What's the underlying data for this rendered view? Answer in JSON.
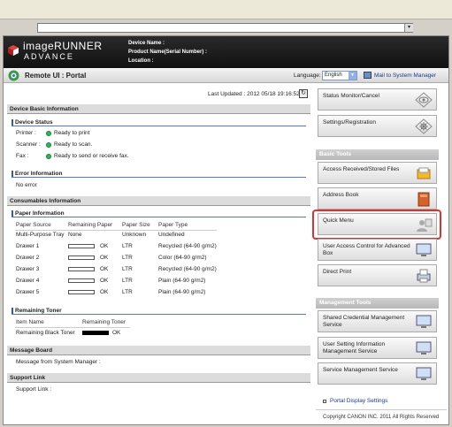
{
  "header": {
    "logo_line1": "imageRUNNER",
    "logo_line2": "ADVANCE",
    "device_name_label": "Device Name :",
    "product_name_label": "Product Name(Serial Number) :",
    "location_label": "Location :"
  },
  "nav": {
    "title": "Remote UI : Portal",
    "language_label": "Language:",
    "language_value": "English",
    "mail_link": "Mail to System Manager"
  },
  "main": {
    "last_updated": "Last Updated : 2012 05/18 19:16:52",
    "device_basic_info": "Device Basic Information",
    "device_status": "Device Status",
    "status_rows": [
      {
        "label": "Printer :",
        "value": "Ready to print"
      },
      {
        "label": "Scanner :",
        "value": "Ready to scan."
      },
      {
        "label": "Fax :",
        "value": "Ready to send or receive fax."
      }
    ],
    "error_info": "Error Information",
    "error_value": "No error",
    "consumables_info": "Consumables Information",
    "paper_info": "Paper Information",
    "paper_headers": [
      "Paper Source",
      "Remaining Paper",
      "Paper Size",
      "Paper Type"
    ],
    "paper_rows": [
      {
        "source": "Multi-Purpose Tray",
        "remaining": "None",
        "size": "Unknown",
        "type": "Undefined",
        "bar": false
      },
      {
        "source": "Drawer 1",
        "remaining": "OK",
        "size": "LTR",
        "type": "Recycled (64-90 g/m2)",
        "bar": true
      },
      {
        "source": "Drawer 2",
        "remaining": "OK",
        "size": "LTR",
        "type": "Color (64-90 g/m2)",
        "bar": true
      },
      {
        "source": "Drawer 3",
        "remaining": "OK",
        "size": "LTR",
        "type": "Recycled (64-90 g/m2)",
        "bar": true
      },
      {
        "source": "Drawer 4",
        "remaining": "OK",
        "size": "LTR",
        "type": "Plain (64-90 g/m2)",
        "bar": true
      },
      {
        "source": "Drawer 5",
        "remaining": "OK",
        "size": "LTR",
        "type": "Plain (64-90 g/m2)",
        "bar": true
      }
    ],
    "remaining_toner": "Remaining Toner",
    "toner_headers": [
      "Item Name",
      "Remaining Toner"
    ],
    "toner_row": {
      "name": "Remaining Black Toner",
      "value": "OK"
    },
    "message_board": "Message Board",
    "message_from": "Message from System Manager :",
    "support_link": "Support Link",
    "support_link_label": "Support Link :"
  },
  "right": {
    "status_monitor": "Status Monitor/Cancel",
    "settings_registration": "Settings/Registration",
    "basic_tools": "Basic Tools",
    "access_files": "Access Received/Stored Files",
    "address_book": "Address Book",
    "quick_menu": "Quick Menu",
    "user_access": "User Access Control for Advanced Box",
    "direct_print": "Direct Print",
    "management_tools": "Management Tools",
    "shared_credential": "Shared Credential Management Service",
    "user_setting": "User Setting Information Management Service",
    "service_mgmt": "Service Management Service",
    "portal_display": "Portal Display Settings",
    "copyright": "Copyright CANON INC. 2011 All Rights Reserved"
  },
  "colors": {
    "highlight": "#e03030",
    "status_ready": "#2fb85a",
    "link": "#1a3a8a"
  }
}
